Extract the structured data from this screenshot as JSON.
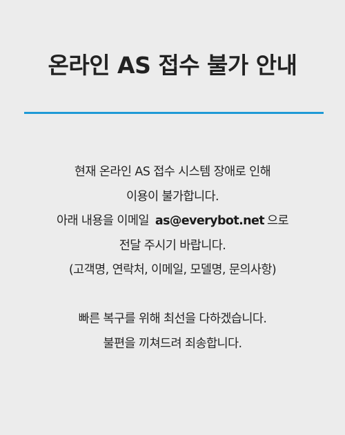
{
  "notice": {
    "title": "온라인 AS 접수 불가 안내",
    "accent_color": "#1e9ad6",
    "line1": "현재 온라인 AS 접수 시스템 장애로 인해",
    "line2": "이용이 불가합니다.",
    "line3_before": "아래 내용을 이메일",
    "email": "as@everybot.net",
    "line3_after": "으로",
    "line4": "전달 주시기 바랍니다.",
    "line5": "(고객명, 연락처, 이메일, 모델명, 문의사항)",
    "line6": "빠른 복구를 위해 최선을 다하겠습니다.",
    "line7": "불편을 끼쳐드려 죄송합니다."
  }
}
